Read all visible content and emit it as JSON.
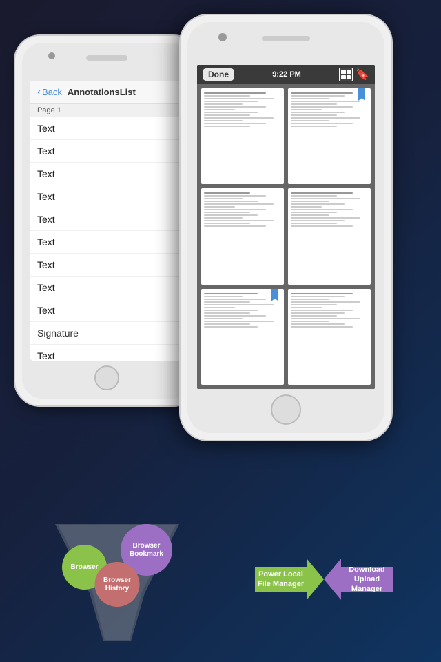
{
  "phone1": {
    "nav": {
      "back_label": "Back",
      "title": "AnnotationsList"
    },
    "page_header": "Page 1",
    "list_items": [
      "Text",
      "Text",
      "Text",
      "Text",
      "Text",
      "Text",
      "Text",
      "Text",
      "Text",
      "Signature",
      "Text"
    ]
  },
  "phone2": {
    "topbar": {
      "done_label": "Done",
      "time": "9:22 PM"
    },
    "pages": [
      {
        "bookmarked": false
      },
      {
        "bookmarked": true
      },
      {
        "bookmarked": false
      },
      {
        "bookmarked": false
      },
      {
        "bookmarked": true
      },
      {
        "bookmarked": false
      }
    ]
  },
  "funnel": {
    "circles": [
      {
        "label": "Browser",
        "class": "fc-browser"
      },
      {
        "label": "Browser Bookmark",
        "class": "fc-bookmark"
      },
      {
        "label": "Browser History",
        "class": "fc-history"
      }
    ]
  },
  "arrows": {
    "left_label": "Power Local\nFile Manager",
    "right_label": "Download\nUpload\nManager"
  }
}
